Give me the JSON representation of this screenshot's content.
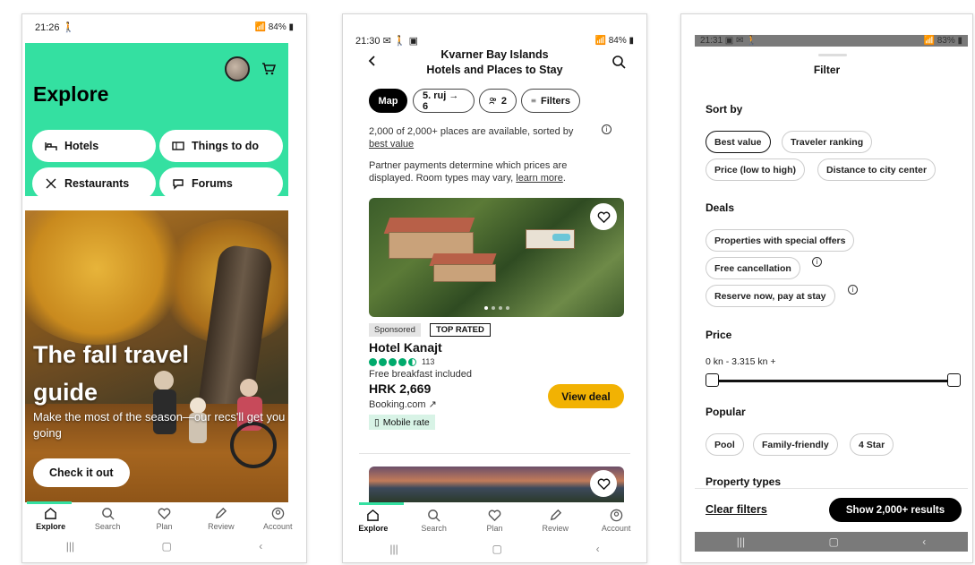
{
  "phone1": {
    "status": {
      "time": "21:26",
      "time_icon": "person-walking-icon",
      "battery": "84%"
    },
    "header": {
      "title": "Explore",
      "avatar_icon": "avatar",
      "cart_icon": "cart-icon"
    },
    "categories": [
      {
        "label": "Hotels",
        "icon": "bed-icon"
      },
      {
        "label": "Things to do",
        "icon": "ticket-icon"
      },
      {
        "label": "Restaurants",
        "icon": "cutlery-icon"
      },
      {
        "label": "Forums",
        "icon": "chat-icon"
      }
    ],
    "hero": {
      "title_line1": "The fall travel",
      "title_line2": "guide",
      "subtitle": "Make the most of the season—our recs'll get you going",
      "button": "Check it out"
    },
    "nav": [
      {
        "label": "Explore",
        "active": true
      },
      {
        "label": "Search",
        "active": false
      },
      {
        "label": "Plan",
        "active": false
      },
      {
        "label": "Review",
        "active": false
      },
      {
        "label": "Account",
        "active": false
      }
    ]
  },
  "phone2": {
    "status": {
      "time": "21:30",
      "battery": "84%"
    },
    "header": {
      "title_line1": "Kvarner Bay Islands",
      "title_line2": "Hotels and Places to Stay"
    },
    "chips": {
      "map": "Map",
      "dates": "5. ruj → 6",
      "guests": "2",
      "filters": "Filters"
    },
    "results_text_a": "2,000 of 2,000+ places are available, sorted by ",
    "results_link": "best value",
    "partner_text": "Partner payments determine which prices are displayed. Room types may vary, ",
    "partner_link": "learn more",
    "partner_end": ".",
    "hotel": {
      "sponsored": "Sponsored",
      "badge": "TOP RATED",
      "name": "Hotel Kanajt",
      "reviews": "113",
      "rating": 4.5,
      "feature": "Free breakfast included",
      "price": "HRK 2,669",
      "provider": "Booking.com ↗",
      "cta": "View deal",
      "mobile_rate": "Mobile rate"
    },
    "nav": [
      {
        "label": "Explore",
        "active": true
      },
      {
        "label": "Search",
        "active": false
      },
      {
        "label": "Plan",
        "active": false
      },
      {
        "label": "Review",
        "active": false
      },
      {
        "label": "Account",
        "active": false
      }
    ]
  },
  "phone3": {
    "status": {
      "time": "21:31",
      "battery": "83%"
    },
    "title": "Filter",
    "sort_by": {
      "label": "Sort by",
      "options": [
        "Best value",
        "Traveler ranking",
        "Price (low to high)",
        "Distance to city center"
      ],
      "selected": "Best value"
    },
    "deals": {
      "label": "Deals",
      "options": [
        "Properties with special offers",
        "Free cancellation",
        "Reserve now, pay at stay"
      ]
    },
    "price": {
      "label": "Price",
      "range": "0 kn - 3.315 kn +"
    },
    "popular": {
      "label": "Popular",
      "options": [
        "Pool",
        "Family-friendly",
        "4 Star"
      ]
    },
    "property_types": {
      "label": "Property types"
    },
    "footer": {
      "clear": "Clear filters",
      "show": "Show 2,000+ results"
    }
  },
  "colors": {
    "brand_green": "#34e0a1",
    "deal_yellow": "#f2b203",
    "rating_green": "#00aa6c"
  }
}
